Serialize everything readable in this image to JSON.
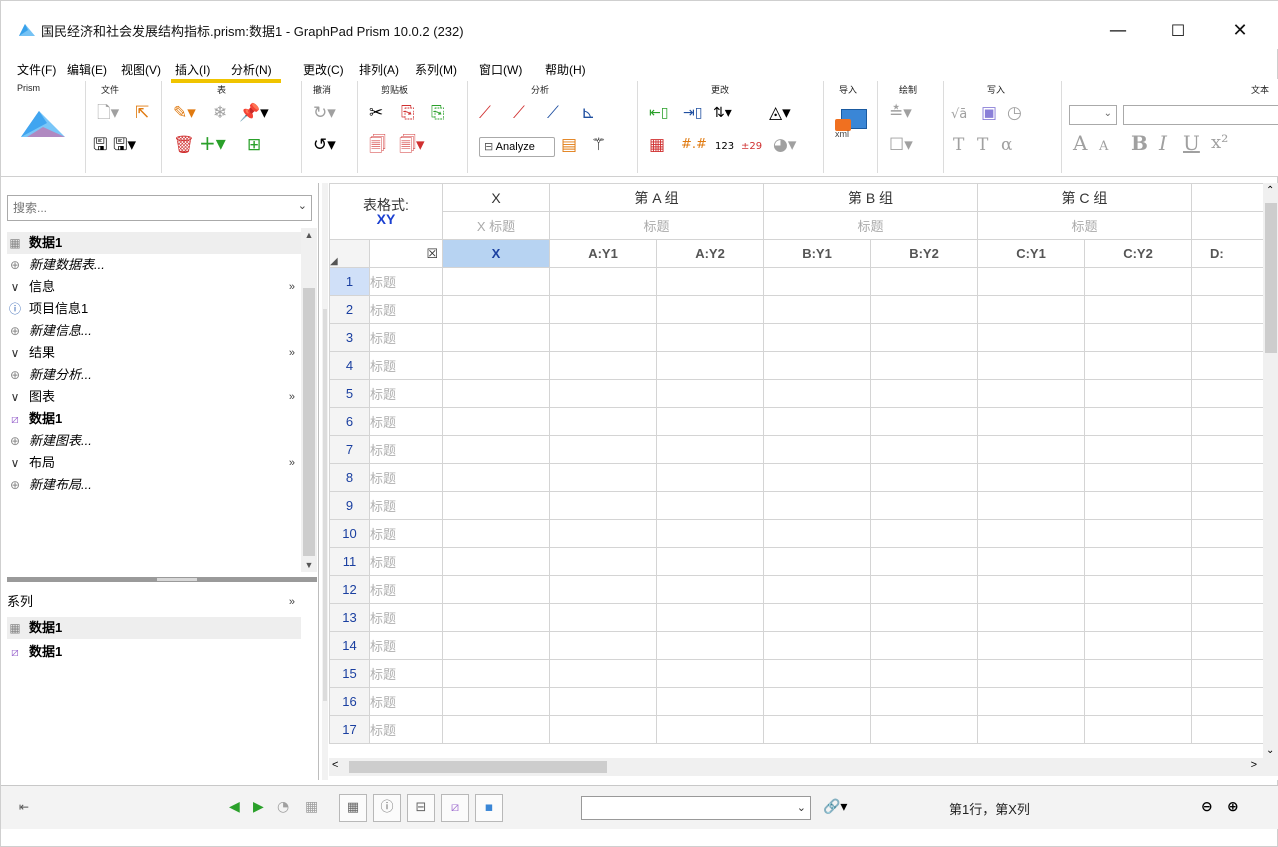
{
  "window": {
    "title": "国民经济和社会发展结构指标.prism:数据1 - GraphPad Prism 10.0.2 (232)",
    "minimize": "—",
    "maximize": "☐",
    "close": "✕"
  },
  "menu": {
    "file": "文件(F)",
    "edit": "编辑(E)",
    "view": "视图(V)",
    "insert": "插入(I)",
    "analyze": "分析(N)",
    "change": "更改(C)",
    "arrange": "排列(A)",
    "family": "系列(M)",
    "window": "窗口(W)",
    "help": "帮助(H)"
  },
  "ribbon": {
    "groups": {
      "prism": "Prism",
      "file": "文件",
      "sheet": "表",
      "undo": "撤消",
      "clipboard": "剪贴板",
      "analysis": "分析",
      "change": "更改",
      "import": "导入",
      "draw": "绘制",
      "write": "写入",
      "text": "文本"
    },
    "analyze_button": "Analyze",
    "import_xml": "xml",
    "text_font_size": "",
    "text_bold": "B",
    "text_italic": "I",
    "text_underline": "U",
    "text_superscript": "x²",
    "text_big_a": "A",
    "text_small_a": "A",
    "text_T": "T",
    "text_T2": "T",
    "alpha": "α",
    "sqrt": "√ā",
    "num_123": "123",
    "num_129": "±29"
  },
  "navigator": {
    "search_placeholder": "搜索...",
    "items": [
      {
        "icon": "table-icon",
        "label": "数据1",
        "kind": "data"
      },
      {
        "icon": "plus-circle-icon",
        "label": "新建数据表...",
        "kind": "new"
      },
      {
        "icon": "chevron-icon",
        "label": "信息",
        "kind": "section"
      },
      {
        "icon": "info-icon",
        "label": "项目信息1",
        "kind": "item"
      },
      {
        "icon": "plus-circle-icon",
        "label": "新建信息...",
        "kind": "new"
      },
      {
        "icon": "chevron-icon",
        "label": "结果",
        "kind": "section"
      },
      {
        "icon": "plus-circle-icon",
        "label": "新建分析...",
        "kind": "new"
      },
      {
        "icon": "chevron-icon",
        "label": "图表",
        "kind": "section"
      },
      {
        "icon": "graph-icon",
        "label": "数据1",
        "kind": "data"
      },
      {
        "icon": "plus-circle-icon",
        "label": "新建图表...",
        "kind": "new"
      },
      {
        "icon": "chevron-icon",
        "label": "布局",
        "kind": "section"
      },
      {
        "icon": "plus-circle-icon",
        "label": "新建布局...",
        "kind": "new"
      }
    ],
    "section_chevron": "»"
  },
  "series_panel": {
    "title": "系列",
    "chevron": "»",
    "items": [
      {
        "icon": "table-icon",
        "label": "数据1"
      },
      {
        "icon": "graph-icon",
        "label": "数据1"
      }
    ]
  },
  "table": {
    "format_label": "表格式:",
    "format_value": "XY",
    "x_header": "X",
    "x_subtitle": "X 标题",
    "groups": [
      {
        "title": "第 A 组",
        "subtitle": "标题"
      },
      {
        "title": "第 B 组",
        "subtitle": "标题"
      },
      {
        "title": "第 C 组",
        "subtitle": "标题"
      }
    ],
    "close_box": "☒",
    "col_x": "X",
    "columns": [
      "A:Y1",
      "A:Y2",
      "B:Y1",
      "B:Y2",
      "C:Y1",
      "C:Y2",
      "D:"
    ],
    "rows": [
      {
        "n": "1",
        "t": "标题"
      },
      {
        "n": "2",
        "t": "标题"
      },
      {
        "n": "3",
        "t": "标题"
      },
      {
        "n": "4",
        "t": "标题"
      },
      {
        "n": "5",
        "t": "标题"
      },
      {
        "n": "6",
        "t": "标题"
      },
      {
        "n": "7",
        "t": "标题"
      },
      {
        "n": "8",
        "t": "标题"
      },
      {
        "n": "9",
        "t": "标题"
      },
      {
        "n": "10",
        "t": "标题"
      },
      {
        "n": "11",
        "t": "标题"
      },
      {
        "n": "12",
        "t": "标题"
      },
      {
        "n": "13",
        "t": "标题"
      },
      {
        "n": "14",
        "t": "标题"
      },
      {
        "n": "15",
        "t": "标题"
      },
      {
        "n": "16",
        "t": "标题"
      },
      {
        "n": "17",
        "t": "标题"
      }
    ]
  },
  "statusbar": {
    "position_text": "第1行，第X列",
    "dropdown_value": ""
  }
}
